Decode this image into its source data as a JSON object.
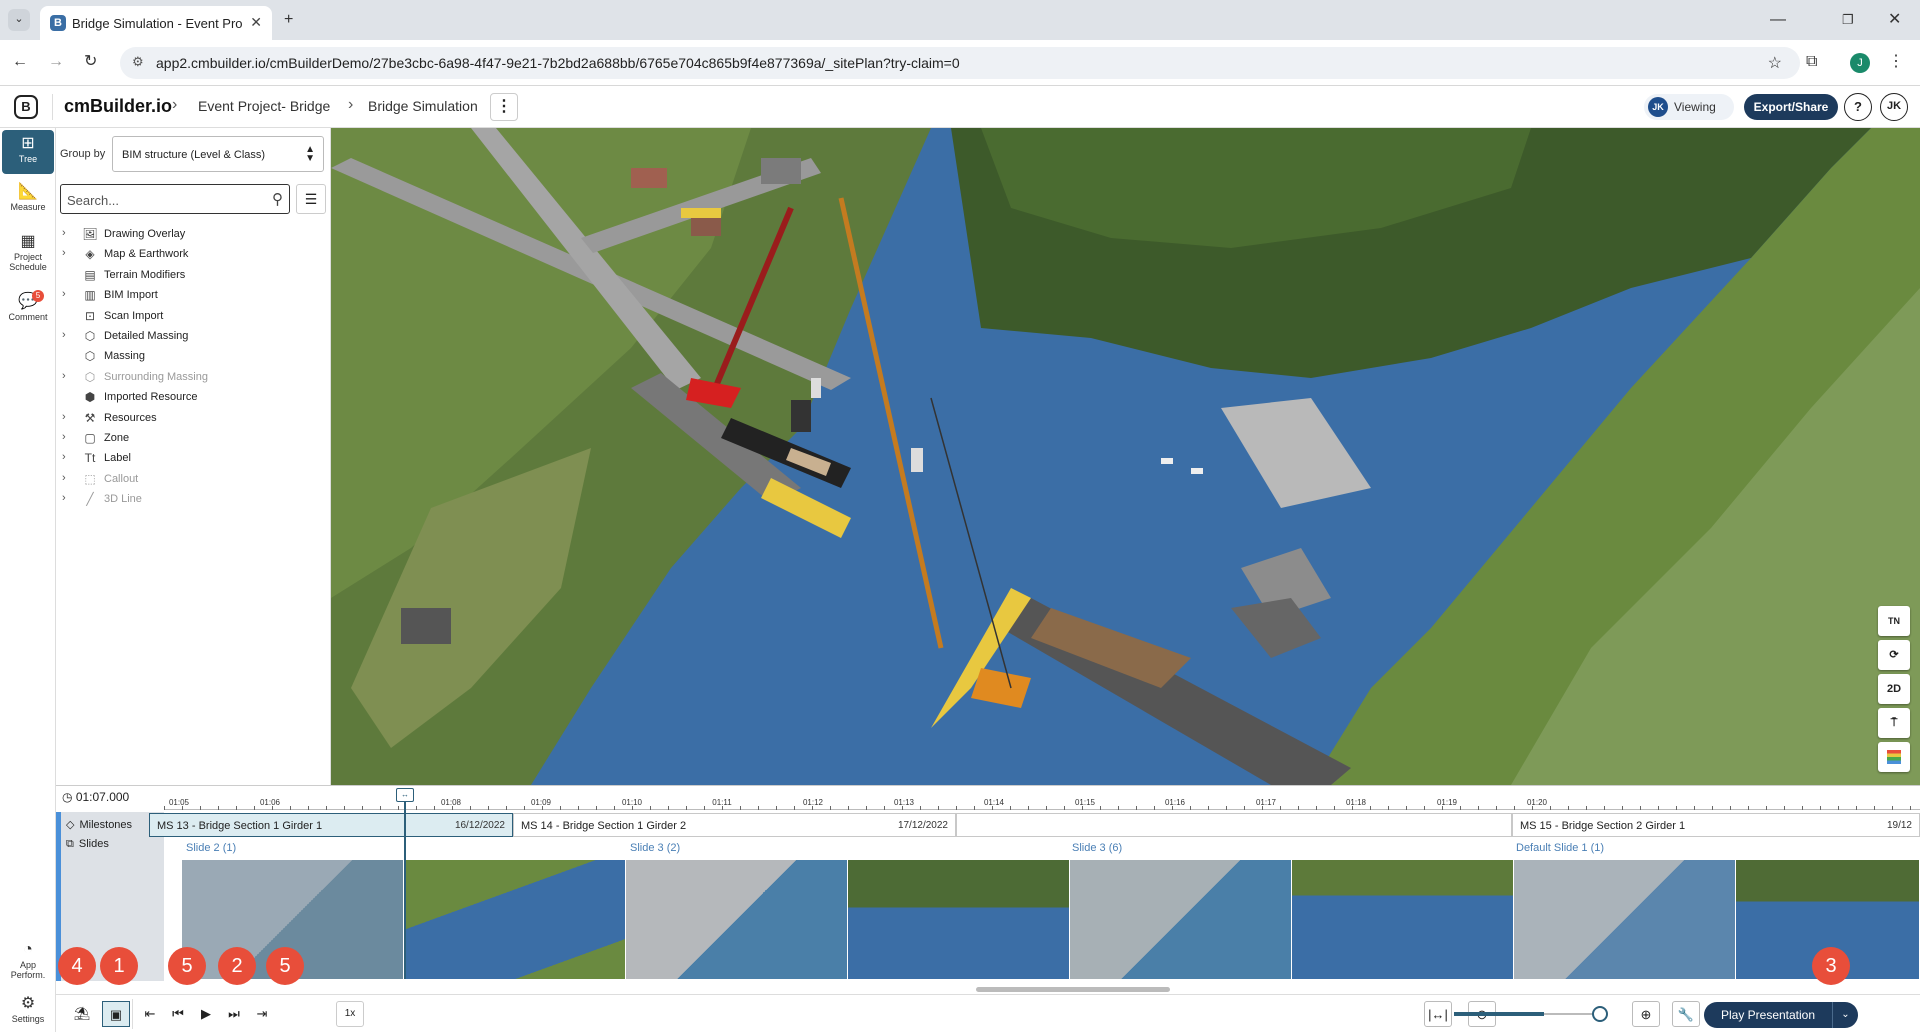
{
  "browser": {
    "tab_title": "Bridge Simulation - Event Proje",
    "url": "app2.cmbuilder.io/cmBuilderDemo/27be3cbc-6a98-4f47-9e21-7b2bd2a688bb/6765e704c865b9f4e877369a/_sitePlan?try-claim=0",
    "profile_initial": "J"
  },
  "header": {
    "brand": "cmBuilder.io",
    "breadcrumb": [
      "Event Project- Bridge",
      "Bridge Simulation"
    ],
    "viewing_initials": "JK",
    "viewing_label": "Viewing",
    "export_label": "Export/Share",
    "help_label": "?",
    "user_initials": "JK"
  },
  "rail": {
    "items": [
      {
        "label": "Tree",
        "icon": "tree-icon"
      },
      {
        "label": "Measure",
        "icon": "ruler-icon"
      },
      {
        "label": "Project Schedule",
        "icon": "calendar-icon"
      },
      {
        "label": "Comment",
        "icon": "comment-icon",
        "badge": "5"
      }
    ],
    "bottom": [
      {
        "label": "App Perform.",
        "icon": "gauge-icon"
      },
      {
        "label": "Settings",
        "icon": "gear-icon"
      }
    ]
  },
  "tree": {
    "group_by_label": "Group by",
    "group_by_value": "BIM structure (Level & Class)",
    "search_placeholder": "Search...",
    "items": [
      {
        "label": "Drawing Overlay",
        "expandable": true,
        "icon": "image-icon"
      },
      {
        "label": "Map & Earthwork",
        "expandable": true,
        "icon": "layers-icon"
      },
      {
        "label": "Terrain Modifiers",
        "expandable": false,
        "icon": "terrain-icon"
      },
      {
        "label": "BIM Import",
        "expandable": true,
        "icon": "bim-icon"
      },
      {
        "label": "Scan Import",
        "expandable": false,
        "icon": "scan-icon"
      },
      {
        "label": "Detailed Massing",
        "expandable": true,
        "icon": "cube-icon"
      },
      {
        "label": "Massing",
        "expandable": false,
        "icon": "cube-icon"
      },
      {
        "label": "Surrounding Massing",
        "expandable": true,
        "icon": "cube-icon",
        "dim": true
      },
      {
        "label": "Imported Resource",
        "expandable": false,
        "icon": "box-icon"
      },
      {
        "label": "Resources",
        "expandable": true,
        "icon": "resources-icon"
      },
      {
        "label": "Zone",
        "expandable": true,
        "icon": "zone-icon"
      },
      {
        "label": "Label",
        "expandable": true,
        "icon": "label-icon"
      },
      {
        "label": "Callout",
        "expandable": true,
        "icon": "callout-icon",
        "dim": true
      },
      {
        "label": "3D Line",
        "expandable": true,
        "icon": "line-icon",
        "dim": true
      }
    ]
  },
  "viewport_tools": [
    "TN",
    "3D",
    "2D",
    "T",
    ""
  ],
  "timeline": {
    "current_time": "01:07.000",
    "ticks": [
      "01:05",
      "01:06",
      "01:08",
      "01:09",
      "01:10",
      "01:11",
      "01:12",
      "01:13",
      "01:14",
      "01:15",
      "01:16",
      "01:17",
      "01:18",
      "01:19",
      "01:20"
    ],
    "track_labels": [
      "Milestones",
      "Slides"
    ],
    "milestone_prefix": "22",
    "milestones": [
      {
        "name": "MS 13 -  Bridge Section 1 Girder 1",
        "date": "16/12/2022",
        "selected": true
      },
      {
        "name": "MS 14 -  Bridge Section 1 Girder 2",
        "date": "17/12/2022",
        "selected": false
      },
      {
        "name": "MS 15 -  Bridge Section 2 Girder 1",
        "date": "19/12",
        "selected": false
      }
    ],
    "slides": [
      "Slide 2 (1)",
      "Slide 3 (2)",
      "Slide 3 (6)",
      "Default Slide 1 (1)"
    ]
  },
  "bottombar": {
    "speed": "1x",
    "zoom_level": 0.6,
    "play_presentation": "Play Presentation"
  },
  "markers": [
    "4",
    "1",
    "5",
    "2",
    "5",
    "3"
  ]
}
